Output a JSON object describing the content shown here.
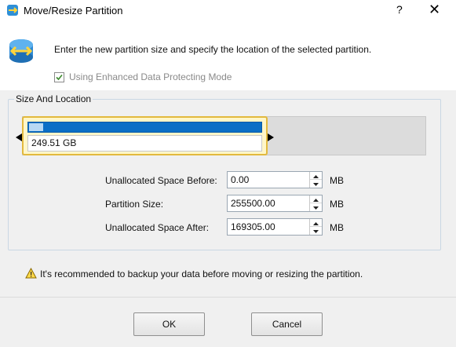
{
  "window": {
    "title": "Move/Resize Partition",
    "help_label": "?",
    "close_label": "✕"
  },
  "header": {
    "instructions": "Enter the new partition size and specify the location of the selected partition.",
    "enhanced_mode": {
      "label": "Using Enhanced Data Protecting Mode",
      "checked": true
    }
  },
  "size_and_location": {
    "group_title": "Size And Location",
    "partition": {
      "size_label": "249.51 GB",
      "used_fraction": 0.06
    },
    "fields": [
      {
        "label": "Unallocated Space Before:",
        "value": "0.00",
        "unit": "MB"
      },
      {
        "label": "Partition Size:",
        "value": "255500.00",
        "unit": "MB"
      },
      {
        "label": "Unallocated Space After:",
        "value": "169305.00",
        "unit": "MB"
      }
    ]
  },
  "warning": {
    "text": "It's recommended to backup your data before moving or resizing the partition.",
    "icon": "warning-icon"
  },
  "buttons": {
    "ok": "OK",
    "cancel": "Cancel"
  },
  "colors": {
    "partition_border": "#e2b93e",
    "partition_fill": "#fff6c8",
    "usage_bar": "#0b6fc6",
    "unallocated": "#dcdcdc"
  }
}
